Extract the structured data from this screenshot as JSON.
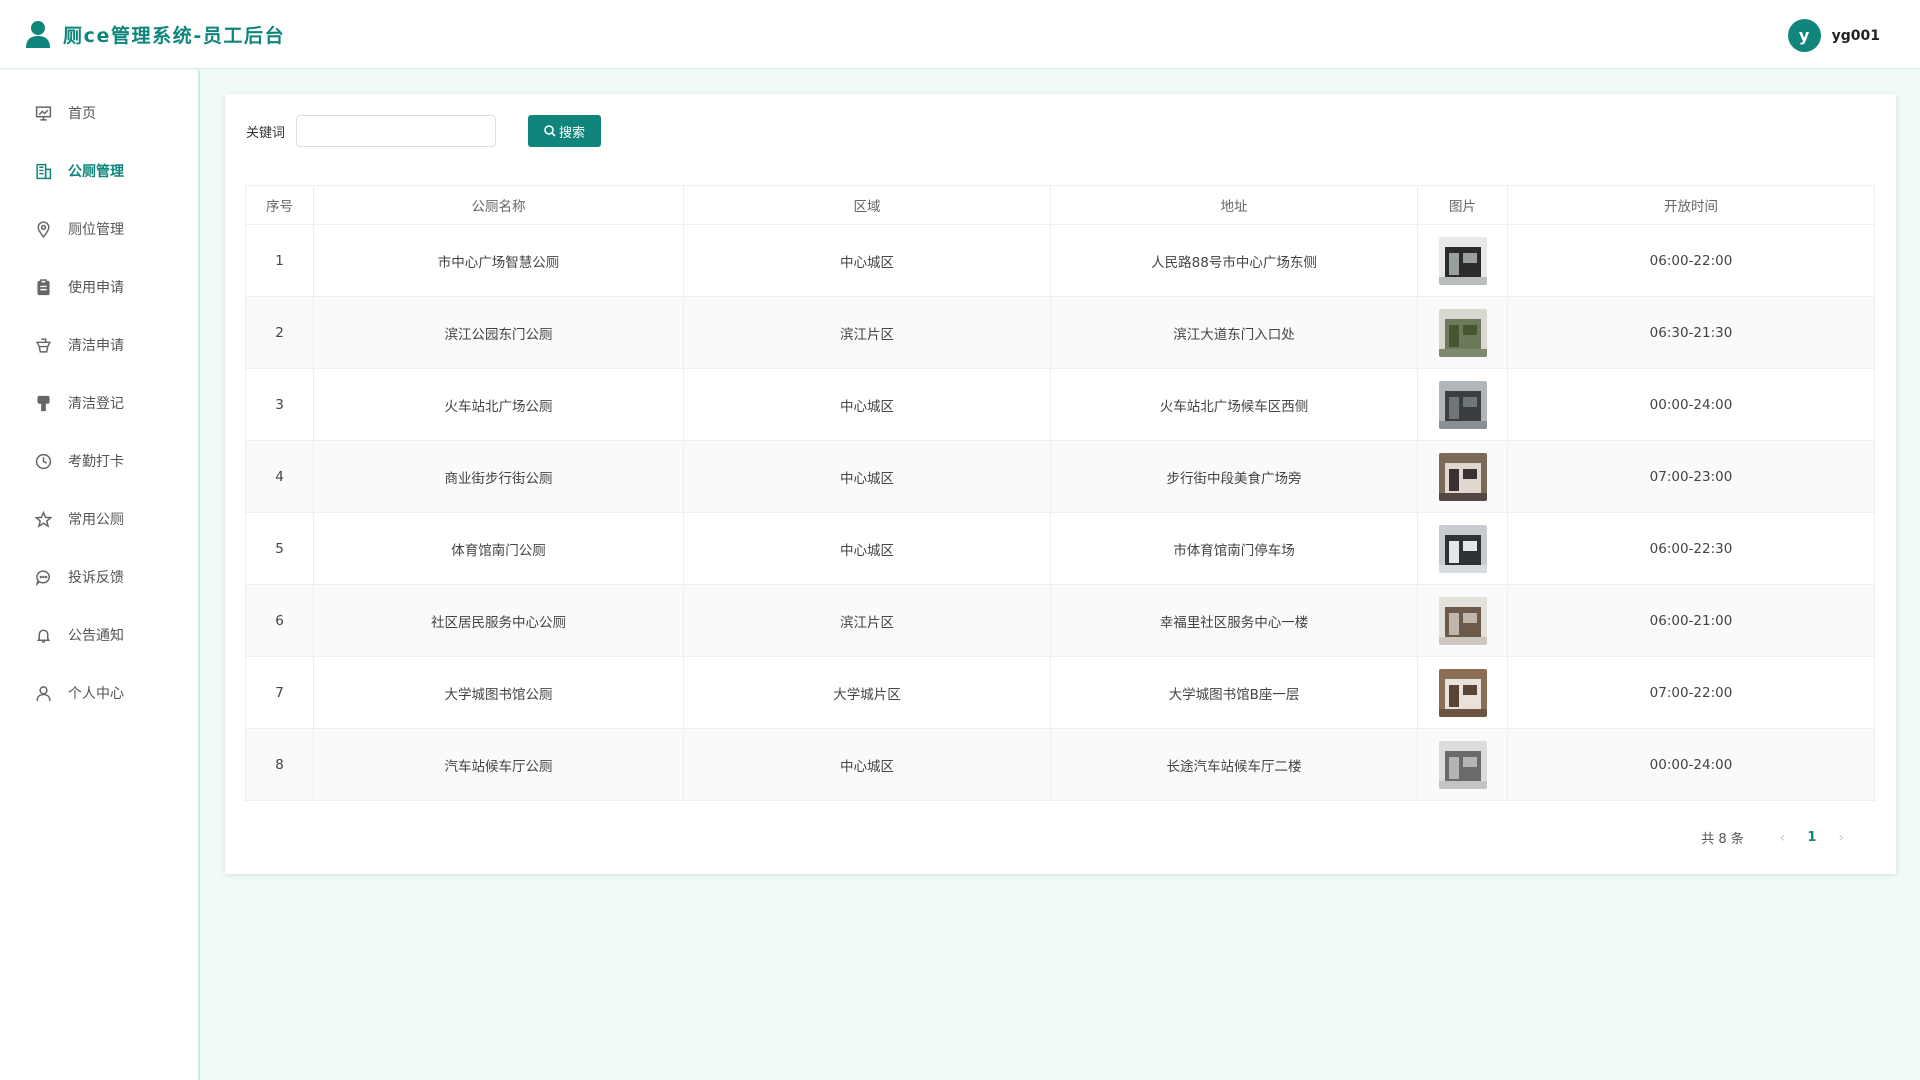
{
  "header": {
    "title": "厕ce管理系统-员工后台",
    "avatar_letter": "y",
    "username": "yg001"
  },
  "sidebar": {
    "items": [
      {
        "label": "首页",
        "icon": "dashboard-icon"
      },
      {
        "label": "公厕管理",
        "icon": "building-icon",
        "active": true
      },
      {
        "label": "厕位管理",
        "icon": "location-icon"
      },
      {
        "label": "使用申请",
        "icon": "clipboard-icon"
      },
      {
        "label": "清洁申请",
        "icon": "cleaning-icon"
      },
      {
        "label": "清洁登记",
        "icon": "brush-icon"
      },
      {
        "label": "考勤打卡",
        "icon": "clock-icon"
      },
      {
        "label": "常用公厕",
        "icon": "star-icon"
      },
      {
        "label": "投诉反馈",
        "icon": "chat-icon"
      },
      {
        "label": "公告通知",
        "icon": "bell-icon"
      },
      {
        "label": "个人中心",
        "icon": "user-icon"
      }
    ]
  },
  "search": {
    "label": "关键词",
    "value": "",
    "placeholder": "",
    "button_label": "搜索"
  },
  "table": {
    "headers": [
      "序号",
      "公厕名称",
      "区域",
      "地址",
      "图片",
      "开放时间"
    ],
    "rows": [
      {
        "idx": "1",
        "name": "市中心广场智慧公厕",
        "area": "中心城区",
        "address": "人民路88号市中心广场东侧",
        "hours": "06:00-22:00"
      },
      {
        "idx": "2",
        "name": "滨江公园东门公厕",
        "area": "滨江片区",
        "address": "滨江大道东门入口处",
        "hours": "06:30-21:30"
      },
      {
        "idx": "3",
        "name": "火车站北广场公厕",
        "area": "中心城区",
        "address": "火车站北广场候车区西侧",
        "hours": "00:00-24:00"
      },
      {
        "idx": "4",
        "name": "商业街步行街公厕",
        "area": "中心城区",
        "address": "步行街中段美食广场旁",
        "hours": "07:00-23:00"
      },
      {
        "idx": "5",
        "name": "体育馆南门公厕",
        "area": "中心城区",
        "address": "市体育馆南门停车场",
        "hours": "06:00-22:30"
      },
      {
        "idx": "6",
        "name": "社区居民服务中心公厕",
        "area": "滨江片区",
        "address": "幸福里社区服务中心一楼",
        "hours": "06:00-21:00"
      },
      {
        "idx": "7",
        "name": "大学城图书馆公厕",
        "area": "大学城片区",
        "address": "大学城图书馆B座一层",
        "hours": "07:00-22:00"
      },
      {
        "idx": "8",
        "name": "汽车站候车厅公厕",
        "area": "中心城区",
        "address": "长途汽车站候车厅二楼",
        "hours": "00:00-24:00"
      }
    ]
  },
  "pager": {
    "total": "共 8 条",
    "current": "1"
  },
  "colors": {
    "accent": "#0f857b",
    "background": "#f0fbf9"
  }
}
